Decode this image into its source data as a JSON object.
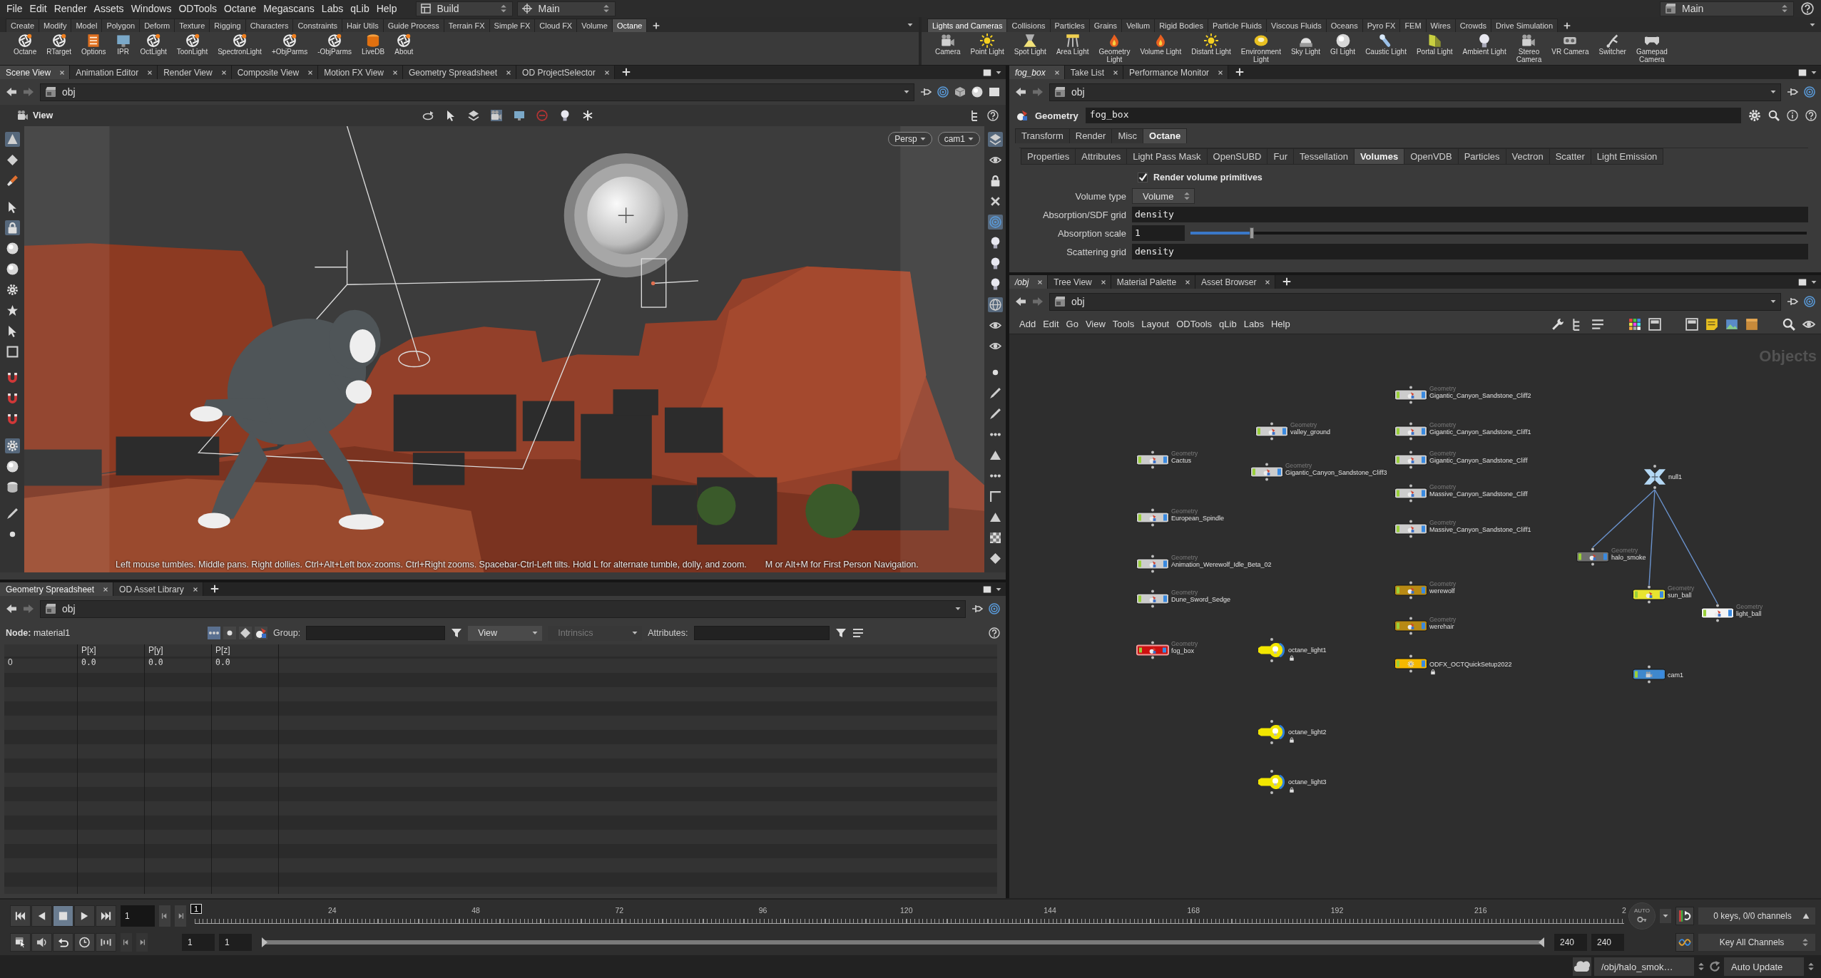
{
  "menu_bar": {
    "items": [
      "File",
      "Edit",
      "Render",
      "Assets",
      "Windows",
      "ODTools",
      "Octane",
      "Megascans",
      "Labs",
      "qLib",
      "Help"
    ],
    "desktop": "Build",
    "context": "Main",
    "secondary_context": "Main"
  },
  "shelves": [
    {
      "tabs": [
        {
          "label": "Create",
          "selected": false
        },
        {
          "label": "Modify",
          "selected": false
        },
        {
          "label": "Model",
          "selected": false
        },
        {
          "label": "Polygon",
          "selected": false
        },
        {
          "label": "Deform",
          "selected": false
        },
        {
          "label": "Texture",
          "selected": false
        },
        {
          "label": "Rigging",
          "selected": false
        },
        {
          "label": "Characters",
          "selected": false
        },
        {
          "label": "Constraints",
          "selected": false
        },
        {
          "label": "Hair Utils",
          "selected": false
        },
        {
          "label": "Guide Process",
          "selected": false
        },
        {
          "label": "Terrain FX",
          "selected": false
        },
        {
          "label": "Simple FX",
          "selected": false
        },
        {
          "label": "Cloud FX",
          "selected": false
        },
        {
          "label": "Volume",
          "selected": false
        },
        {
          "label": "Octane",
          "selected": true
        }
      ],
      "tools": [
        "Octane",
        "RTarget",
        "Options",
        "IPR",
        "OctLight",
        "ToonLight",
        "SpectronLight",
        "+ObjParms",
        "-ObjParms",
        "LiveDB",
        "About"
      ]
    },
    {
      "tabs": [
        {
          "label": "Lights and Cameras",
          "selected": true
        },
        {
          "label": "Collisions",
          "selected": false
        },
        {
          "label": "Particles",
          "selected": false
        },
        {
          "label": "Grains",
          "selected": false
        },
        {
          "label": "Vellum",
          "selected": false
        },
        {
          "label": "Rigid Bodies",
          "selected": false
        },
        {
          "label": "Particle Fluids",
          "selected": false
        },
        {
          "label": "Viscous Fluids",
          "selected": false
        },
        {
          "label": "Oceans",
          "selected": false
        },
        {
          "label": "Pyro FX",
          "selected": false
        },
        {
          "label": "FEM",
          "selected": false
        },
        {
          "label": "Wires",
          "selected": false
        },
        {
          "label": "Crowds",
          "selected": false
        },
        {
          "label": "Drive Simulation",
          "selected": false
        }
      ],
      "tools": [
        "Camera",
        "Point Light",
        "Spot Light",
        "Area Light",
        "Geometry\nLight",
        "Volume Light",
        "Distant Light",
        "Environment\nLight",
        "Sky Light",
        "GI Light",
        "Caustic Light",
        "Portal Light",
        "Ambient Light",
        "Stereo\nCamera",
        "VR Camera",
        "Switcher",
        "Gamepad\nCamera"
      ]
    }
  ],
  "scene_pane": {
    "tabs": [
      {
        "label": "Scene View",
        "selected": true
      },
      {
        "label": "Animation Editor",
        "selected": false
      },
      {
        "label": "Render View",
        "selected": false
      },
      {
        "label": "Composite View",
        "selected": false
      },
      {
        "label": "Motion FX View",
        "selected": false
      },
      {
        "label": "Geometry Spreadsheet",
        "selected": false
      },
      {
        "label": "OD ProjectSelector",
        "selected": false
      }
    ],
    "path": "obj",
    "viewer": {
      "title": "View",
      "projection": "Persp",
      "camera": "cam1",
      "hint": "Left mouse tumbles. Middle pans. Right dollies. Ctrl+Alt+Left box-zooms. Ctrl+Right zooms. Spacebar-Ctrl-Left tilts. Hold L for alternate tumble, dolly, and zoom.",
      "hint_extra": "M or Alt+M for First Person Navigation.",
      "left_tools": [
        {
          "selected": true
        },
        {
          "selected": false
        },
        {
          "selected": false
        },
        {
          "selected": false
        },
        {
          "selected": true
        },
        {
          "selected": false
        },
        {
          "selected": false
        },
        {
          "selected": false
        },
        {
          "selected": false
        },
        {
          "selected": false
        },
        {
          "selected": false
        },
        {
          "selected": false
        },
        {
          "selected": false
        },
        {
          "selected": false
        },
        {
          "selected": true
        },
        {
          "selected": false
        },
        {
          "selected": false
        },
        {
          "selected": false
        },
        {
          "selected": false
        }
      ],
      "right_tools": [
        {
          "selected": true
        },
        {
          "selected": false
        },
        {
          "selected": false
        },
        {
          "selected": false
        },
        {
          "selected": true
        },
        {
          "selected": false
        },
        {
          "selected": false
        },
        {
          "selected": false
        },
        {
          "selected": true
        },
        {
          "selected": false
        },
        {
          "selected": false
        },
        {
          "selected": false
        },
        {
          "selected": false
        },
        {
          "selected": false
        },
        {
          "selected": false
        },
        {
          "selected": false
        },
        {
          "selected": false
        },
        {
          "selected": false
        },
        {
          "selected": false
        },
        {
          "selected": false
        },
        {
          "selected": false
        }
      ]
    }
  },
  "spreadsheet_pane": {
    "tabs": [
      {
        "label": "Geometry Spreadsheet",
        "selected": true
      },
      {
        "label": "OD Asset Library",
        "selected": false
      }
    ],
    "path": "obj",
    "node": "**Node:** material1",
    "class_toggles": [
      {
        "selected": true
      },
      {
        "selected": false
      },
      {
        "selected": false
      },
      {
        "selected": false
      }
    ],
    "group_label": "Group:",
    "menus": [
      {
        "label": "View",
        "disabled": false
      },
      {
        "label": "Intrinsics",
        "disabled": true
      }
    ],
    "attributes_label": "Attributes:",
    "columns": [
      "P[x]",
      "P[y]",
      "P[z]"
    ],
    "rows": [
      {
        "index": "0",
        "cells": [
          "0.0",
          "0.0",
          "0.0"
        ]
      }
    ]
  },
  "parameter_pane": {
    "tabs": [
      {
        "label": "fog_box",
        "selected": true,
        "linked": true
      },
      {
        "label": "Take List",
        "selected": false,
        "linked": false
      },
      {
        "label": "Performance Monitor",
        "selected": false,
        "linked": false
      }
    ],
    "path": "obj",
    "node_type": "Geometry",
    "node_name": "fog_box",
    "folder_tabs": [
      {
        "label": "Transform",
        "selected": false
      },
      {
        "label": "Render",
        "selected": false
      },
      {
        "label": "Misc",
        "selected": false
      },
      {
        "label": "Octane",
        "selected": true
      }
    ],
    "subfolder_tabs": [
      {
        "label": "Properties",
        "selected": false
      },
      {
        "label": "Attributes",
        "selected": false
      },
      {
        "label": "Light Pass Mask",
        "selected": false
      },
      {
        "label": "OpenSUBD",
        "selected": false
      },
      {
        "label": "Fur",
        "selected": false
      },
      {
        "label": "Tessellation",
        "selected": false
      },
      {
        "label": "Volumes",
        "selected": true
      },
      {
        "label": "OpenVDB",
        "selected": false
      },
      {
        "label": "Particles",
        "selected": false
      },
      {
        "label": "Vectron",
        "selected": false
      },
      {
        "label": "Scatter",
        "selected": false
      },
      {
        "label": "Light Emission",
        "selected": false
      }
    ],
    "parameters": [
      {
        "kind": "toggle",
        "label": "Render volume primitives",
        "checked": true
      },
      {
        "kind": "menu",
        "label": "Volume type",
        "value": "Volume"
      },
      {
        "kind": "string",
        "label": "Absorption/SDF grid",
        "value": "density"
      },
      {
        "kind": "slider",
        "label": "Absorption scale",
        "value": "1",
        "level": 0.1
      },
      {
        "kind": "string",
        "label": "Scattering grid",
        "value": "density"
      }
    ]
  },
  "network_pane": {
    "tabs": [
      {
        "label": "/obj",
        "selected": true,
        "linked": true
      },
      {
        "label": "Tree View",
        "selected": false,
        "linked": false
      },
      {
        "label": "Material Palette",
        "selected": false,
        "linked": false
      },
      {
        "label": "Asset Browser",
        "selected": false,
        "linked": false
      }
    ],
    "path": "obj",
    "menu": [
      "Add",
      "Edit",
      "Go",
      "View",
      "Tools",
      "Layout",
      "ODTools",
      "qLib",
      "Labs",
      "Help"
    ],
    "context": "Objects",
    "nodes": [
      {
        "kind": "geometry",
        "type": "Geometry",
        "name": "Gigantic_Canyon_Sandstone_Cliff2",
        "color": "#cccccc",
        "selected": false,
        "locked": false
      },
      {
        "kind": "geometry",
        "type": "Geometry",
        "name": "valley_ground",
        "color": "#cccccc",
        "selected": false,
        "locked": false
      },
      {
        "kind": "geometry",
        "type": "Geometry",
        "name": "Gigantic_Canyon_Sandstone_Cliff1",
        "color": "#cccccc",
        "selected": false,
        "locked": false
      },
      {
        "kind": "geometry",
        "type": "Geometry",
        "name": "Cactus",
        "color": "#cccccc",
        "selected": false,
        "locked": false
      },
      {
        "kind": "geometry",
        "type": "Geometry",
        "name": "Gigantic_Canyon_Sandstone_Cliff",
        "color": "#cccccc",
        "selected": false,
        "locked": false
      },
      {
        "kind": "geometry",
        "type": "Geometry",
        "name": "Gigantic_Canyon_Sandstone_Cliff3",
        "color": "#cccccc",
        "selected": false,
        "locked": false
      },
      {
        "kind": "null",
        "name": "null1",
        "color": "#b4d8f4",
        "selected": false,
        "locked": false,
        "children": [
          {
            "kind": "geometry",
            "type": "Geometry",
            "name": "halo_smoke",
            "color": "#6e6e6e",
            "selected": false,
            "locked": false
          },
          {
            "kind": "geometry",
            "type": "Geometry",
            "name": "sun_ball",
            "color": "#e8e430",
            "selected": false,
            "locked": false
          },
          {
            "kind": "geometry",
            "type": "Geometry",
            "name": "light_ball",
            "color": "#f4f4f4",
            "selected": false,
            "locked": false
          }
        ]
      },
      {
        "kind": "geometry",
        "type": "Geometry",
        "name": "Massive_Canyon_Sandstone_Cliff",
        "color": "#cccccc",
        "selected": false,
        "locked": false
      },
      {
        "kind": "geometry",
        "type": "Geometry",
        "name": "European_Spindle",
        "color": "#cccccc",
        "selected": false,
        "locked": false
      },
      {
        "kind": "geometry",
        "type": "Geometry",
        "name": "Massive_Canyon_Sandstone_Cliff1",
        "color": "#cccccc",
        "selected": false,
        "locked": false
      },
      {
        "kind": "geometry",
        "type": "Geometry",
        "name": "Animation_Werewolf_Idle_Beta_02",
        "color": "#cccccc",
        "selected": false,
        "locked": false
      },
      {
        "kind": "geometry",
        "type": "Geometry",
        "name": "werewolf",
        "color": "#b88a14",
        "selected": false,
        "locked": false
      },
      {
        "kind": "geometry",
        "type": "Geometry",
        "name": "Dune_Sword_Sedge",
        "color": "#cccccc",
        "selected": false,
        "locked": false
      },
      {
        "kind": "geometry",
        "type": "Geometry",
        "name": "werehair",
        "color": "#b88a14",
        "selected": false,
        "locked": false
      },
      {
        "kind": "geometry",
        "type": "Geometry",
        "name": "fog_box",
        "color": "#cc1010",
        "selected": true,
        "locked": false
      },
      {
        "kind": "light",
        "name": "octane_light1",
        "color": "#f2e600",
        "selected": false,
        "locked": true
      },
      {
        "kind": "subnet",
        "name": "ODFX_OCTQuickSetup2022",
        "color": "#f5b800",
        "selected": false,
        "locked": true
      },
      {
        "kind": "camera",
        "name": "cam1",
        "color": "#3f88cc",
        "selected": false,
        "locked": false
      },
      {
        "kind": "light",
        "name": "octane_light2",
        "color": "#f2e600",
        "selected": false,
        "locked": true
      },
      {
        "kind": "light",
        "name": "octane_light3",
        "color": "#f2e600",
        "selected": false,
        "locked": true
      }
    ]
  },
  "timeline": {
    "current_frame": "1",
    "marker": "1",
    "ticks": [
      "24",
      "48",
      "72",
      "96",
      "120",
      "144",
      "168",
      "192",
      "216",
      "2"
    ],
    "start": "1",
    "range_start": "1",
    "range": {
      "level": 1
    },
    "range_end": "240",
    "end": "240",
    "auto_key": "AUTO",
    "keys_info": "0 keys, 0/0 channels",
    "key_button": "Key All Channels"
  },
  "status_bar": {
    "path": "/obj/halo_smok…",
    "update_mode": "Auto Update"
  }
}
